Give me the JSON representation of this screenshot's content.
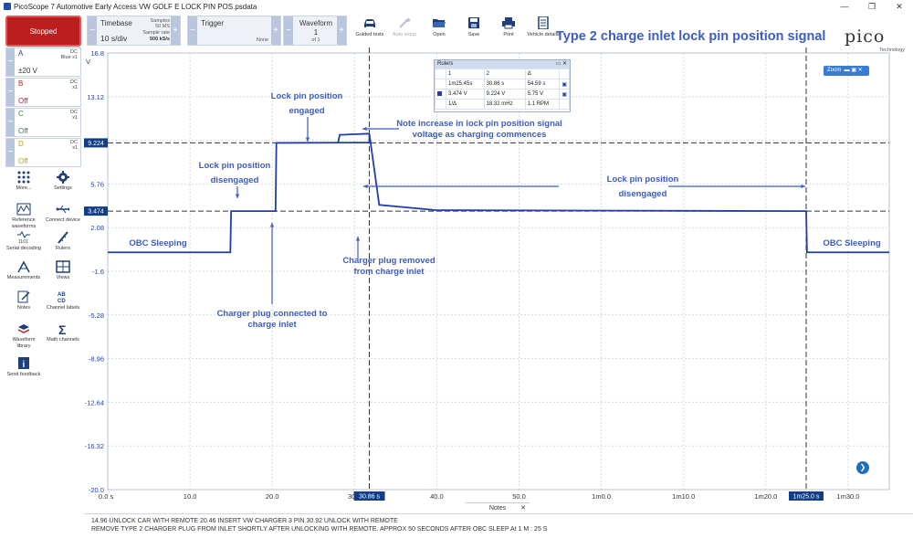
{
  "window": {
    "title": "PicoScope 7 Automotive Early Access VW GOLF E LOCK PIN POS.psdata",
    "buttons": [
      "—",
      "❐",
      "✕"
    ]
  },
  "toolbar": {
    "run_label": "Stopped",
    "timebase": {
      "label": "Timebase",
      "value": "10 s/div",
      "samples_label": "Samples",
      "samples_value": "50 MS",
      "rate_label": "Sample rate",
      "rate_value": "500 kS/s"
    },
    "trigger": {
      "label": "Trigger",
      "mode": "None"
    },
    "waveform": {
      "label": "Waveform",
      "current": "1",
      "total": "of 1"
    },
    "tools": [
      {
        "label": "Guided tests",
        "icon": "car-icon",
        "enabled": true
      },
      {
        "label": "Auto setup",
        "icon": "wand-icon",
        "enabled": false
      },
      {
        "label": "Open",
        "icon": "folder-icon",
        "enabled": true
      },
      {
        "label": "Save",
        "icon": "save-icon",
        "enabled": true
      },
      {
        "label": "Print",
        "icon": "printer-icon",
        "enabled": true
      },
      {
        "label": "Vehicle details",
        "icon": "document-icon",
        "enabled": true
      }
    ],
    "heading": "Type 2 charge inlet lock pin position signal",
    "logo": {
      "word": "pico",
      "sub": "Technology"
    }
  },
  "channels": [
    {
      "letter": "A",
      "coupling": "DC",
      "probe": "Blue x1",
      "range": "±20 V",
      "off": false,
      "color": "#1f3fa8"
    },
    {
      "letter": "B",
      "coupling": "DC",
      "probe": "x1",
      "range": "Off",
      "off": true,
      "color": "#c21e1e"
    },
    {
      "letter": "C",
      "coupling": "DC",
      "probe": "x1",
      "range": "Off",
      "off": true,
      "color": "#2e8b2e"
    },
    {
      "letter": "D",
      "coupling": "DC",
      "probe": "x1",
      "range": "Off",
      "off": true,
      "color": "#c8a000"
    }
  ],
  "sidebar_tools": [
    {
      "label": "More...",
      "icon": "grid-dots-icon"
    },
    {
      "label": "Settings",
      "icon": "gear-icon"
    },
    {
      "label": "Reference waveforms",
      "icon": "reference-waveform-icon"
    },
    {
      "label": "Connect device",
      "icon": "usb-icon"
    },
    {
      "label": "Serial decoding",
      "icon": "serial-decoding-icon"
    },
    {
      "label": "Rulers",
      "icon": "ruler-icon"
    },
    {
      "label": "Measurements",
      "icon": "measurement-icon"
    },
    {
      "label": "Views",
      "icon": "views-icon"
    },
    {
      "label": "Notes",
      "icon": "notes-icon"
    },
    {
      "label": "Channel labels",
      "icon": "channel-labels-icon"
    },
    {
      "label": "Waveform library",
      "icon": "waveform-library-icon"
    },
    {
      "label": "Math channels",
      "icon": "sigma-icon"
    },
    {
      "label": "Send feedback",
      "icon": "info-icon"
    }
  ],
  "axis": {
    "y_unit": "V",
    "y_ticks": [
      "16.8",
      "13.12",
      "9.44",
      "5.76",
      "2.08",
      "-1.6",
      "-5.28",
      "-8.96",
      "-12.64",
      "-16.32",
      "-20.0"
    ],
    "x_ticks": [
      "0.0 s",
      "10.0",
      "20.0",
      "30.0",
      "40.0",
      "50.0",
      "1m0.0",
      "1m10.0",
      "1m20.0",
      "1m30.0"
    ]
  },
  "rulers": {
    "title": "Rulers",
    "time_cursor_1": "30.86 s",
    "time_cursor_2": "1m25.0 s",
    "voltage_cursor_1": "9.224",
    "voltage_cursor_2": "3.474",
    "table": {
      "headers": [
        "1",
        "2",
        "Δ"
      ],
      "time_row": [
        "1m25.45s",
        "30.86 s",
        "54.59 s"
      ],
      "volt_row": [
        "3.474 V",
        "9.224 V",
        "5.75 V"
      ],
      "freq_row": [
        "1/Δ",
        "18.32 mHz",
        "1.1 RPM"
      ]
    }
  },
  "zoom_label": "Zoom",
  "annotations": [
    {
      "text": "OBC Sleeping"
    },
    {
      "text": "Lock pin position"
    },
    {
      "text": "disengaged"
    },
    {
      "text": "Lock pin position"
    },
    {
      "text": "engaged"
    },
    {
      "text": "Note increase in lock pin position signal"
    },
    {
      "text": "voltage  as charging commences"
    },
    {
      "text": "Lock pin position"
    },
    {
      "text": "disengaged"
    },
    {
      "text": "OBC Sleeping"
    },
    {
      "text": "Charger plug removed"
    },
    {
      "text": "from charge inlet"
    },
    {
      "text": "Charger plug connected to"
    },
    {
      "text": "charge inlet"
    }
  ],
  "notes": {
    "tab_label": "Notes",
    "line1": "14.96 UNLOCK CAR WITH REMOTE 20.46 INSERT  VW CHARGER 3 PIN 30.92 UNLOCK WITH REMOTE",
    "line2": "REMOVE TYPE 2 CHARGER PLUG FROM INLET SHORTLY AFTER UNLOCKING WITH REMOTE. APPROX 50 SECONDS AFTER OBC SLEEP At 1 M : 25 S"
  },
  "chart_data": {
    "type": "line",
    "ylabel": "V",
    "ylim": [
      -20.0,
      16.8
    ],
    "xlim": [
      0,
      95
    ],
    "grid": true,
    "series": [
      {
        "color": "#1f3fa8",
        "x": [
          0,
          14.9,
          15.0,
          20.4,
          20.5,
          31.8,
          31.8,
          33.0,
          40.0,
          84.9,
          85.0,
          95.0
        ],
        "y": [
          0.0,
          0.0,
          3.47,
          3.47,
          9.22,
          9.25,
          10.0,
          4.0,
          3.55,
          3.47,
          0.0,
          0.0
        ]
      }
    ]
  }
}
